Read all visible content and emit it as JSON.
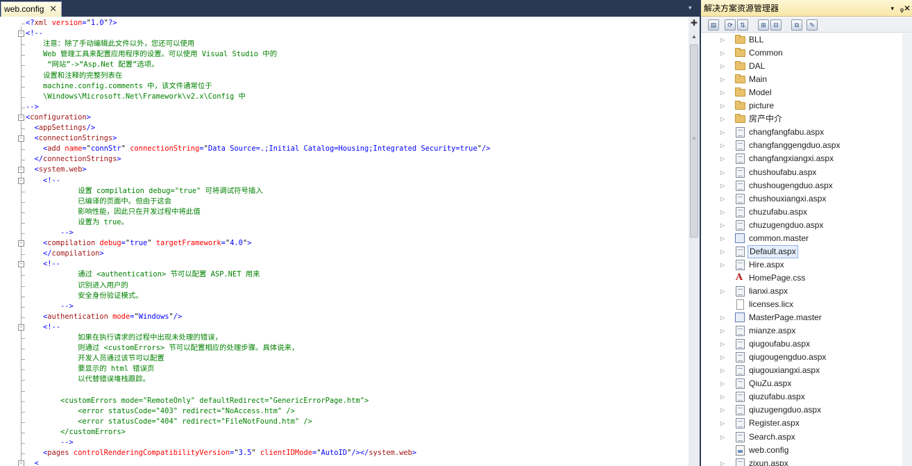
{
  "editor": {
    "tab_title": "web.config",
    "tab_close": "✕",
    "dropdown": "▾",
    "split_icon": "✚",
    "code": [
      {
        "fold": "",
        "parts": [
          [
            "bl",
            "<?"
          ],
          [
            "mr",
            "xml"
          ],
          [
            "bl",
            " "
          ],
          [
            "ar",
            "version"
          ],
          [
            "bl",
            "="
          ],
          [
            "tx",
            "\""
          ],
          [
            "bl",
            "1.0"
          ],
          [
            "tx",
            "\""
          ],
          [
            "bl",
            "?>"
          ]
        ]
      },
      {
        "fold": "-",
        "parts": [
          [
            "bl",
            "<!--"
          ]
        ]
      },
      {
        "fold": "",
        "parts": [
          [
            "cm",
            "    注意：除了手动编辑此文件以外，您还可以使用"
          ]
        ]
      },
      {
        "fold": "",
        "parts": [
          [
            "cm",
            "    Web 管理工具来配置应用程序的设置。可以使用 Visual Studio 中的"
          ]
        ]
      },
      {
        "fold": "",
        "parts": [
          [
            "cm",
            "     “网站”->“Asp.Net 配置”选项。"
          ]
        ]
      },
      {
        "fold": "",
        "parts": [
          [
            "cm",
            "    设置和注释的完整列表在"
          ]
        ]
      },
      {
        "fold": "",
        "parts": [
          [
            "cm",
            "    machine.config.comments 中，该文件通常位于"
          ]
        ]
      },
      {
        "fold": "",
        "parts": [
          [
            "cm",
            "    \\Windows\\Microsoft.Net\\Framework\\v2.x\\Config 中"
          ]
        ]
      },
      {
        "fold": "",
        "parts": [
          [
            "bl",
            "-->"
          ]
        ]
      },
      {
        "fold": "-",
        "parts": [
          [
            "bl",
            "<"
          ],
          [
            "mr",
            "configuration"
          ],
          [
            "bl",
            ">"
          ]
        ]
      },
      {
        "fold": "",
        "parts": [
          [
            "bl",
            "  <"
          ],
          [
            "mr",
            "appSettings"
          ],
          [
            "bl",
            "/>"
          ]
        ]
      },
      {
        "fold": "-",
        "parts": [
          [
            "bl",
            "  <"
          ],
          [
            "mr",
            "connectionStrings"
          ],
          [
            "bl",
            ">"
          ]
        ]
      },
      {
        "fold": "",
        "parts": [
          [
            "bl",
            "    <"
          ],
          [
            "mr",
            "add"
          ],
          [
            "bl",
            " "
          ],
          [
            "ar",
            "name"
          ],
          [
            "bl",
            "="
          ],
          [
            "tx",
            "\""
          ],
          [
            "bl",
            "connStr"
          ],
          [
            "tx",
            "\""
          ],
          [
            "bl",
            " "
          ],
          [
            "ar",
            "connectionString"
          ],
          [
            "bl",
            "="
          ],
          [
            "tx",
            "\""
          ],
          [
            "bl",
            "Data Source=.;Initial Catalog=Housing;Integrated Security=true"
          ],
          [
            "tx",
            "\""
          ],
          [
            "bl",
            "/>"
          ]
        ]
      },
      {
        "fold": "",
        "parts": [
          [
            "bl",
            "  </"
          ],
          [
            "mr",
            "connectionStrings"
          ],
          [
            "bl",
            ">"
          ]
        ]
      },
      {
        "fold": "-",
        "parts": [
          [
            "bl",
            "  <"
          ],
          [
            "mr",
            "system.web"
          ],
          [
            "bl",
            ">"
          ]
        ]
      },
      {
        "fold": "-",
        "parts": [
          [
            "bl",
            "    <!--"
          ]
        ]
      },
      {
        "fold": "",
        "parts": [
          [
            "cm",
            "            设置 compilation debug=\"true\" 可将调试符号插入"
          ]
        ]
      },
      {
        "fold": "",
        "parts": [
          [
            "cm",
            "            已编译的页面中。但由于这会"
          ]
        ]
      },
      {
        "fold": "",
        "parts": [
          [
            "cm",
            "            影响性能，因此只在开发过程中将此值"
          ]
        ]
      },
      {
        "fold": "",
        "parts": [
          [
            "cm",
            "            设置为 true。"
          ]
        ]
      },
      {
        "fold": "",
        "parts": [
          [
            "bl",
            "        -->"
          ]
        ]
      },
      {
        "fold": "-",
        "parts": [
          [
            "bl",
            "    <"
          ],
          [
            "mr",
            "compilation"
          ],
          [
            "bl",
            " "
          ],
          [
            "ar",
            "debug"
          ],
          [
            "bl",
            "="
          ],
          [
            "tx",
            "\""
          ],
          [
            "bl",
            "true"
          ],
          [
            "tx",
            "\""
          ],
          [
            "bl",
            " "
          ],
          [
            "ar",
            "targetFramework"
          ],
          [
            "bl",
            "="
          ],
          [
            "tx",
            "\""
          ],
          [
            "bl",
            "4.0"
          ],
          [
            "tx",
            "\""
          ],
          [
            "bl",
            ">"
          ]
        ]
      },
      {
        "fold": "",
        "parts": [
          [
            "bl",
            "    </"
          ],
          [
            "mr",
            "compilation"
          ],
          [
            "bl",
            ">"
          ]
        ]
      },
      {
        "fold": "-",
        "parts": [
          [
            "bl",
            "    <!--"
          ]
        ]
      },
      {
        "fold": "",
        "parts": [
          [
            "cm",
            "            通过 <authentication> 节可以配置 ASP.NET 用来"
          ]
        ]
      },
      {
        "fold": "",
        "parts": [
          [
            "cm",
            "            识别进入用户的"
          ]
        ]
      },
      {
        "fold": "",
        "parts": [
          [
            "cm",
            "            安全身份验证模式。"
          ]
        ]
      },
      {
        "fold": "",
        "parts": [
          [
            "bl",
            "        -->"
          ]
        ]
      },
      {
        "fold": "",
        "parts": [
          [
            "bl",
            "    <"
          ],
          [
            "mr",
            "authentication"
          ],
          [
            "bl",
            " "
          ],
          [
            "ar",
            "mode"
          ],
          [
            "bl",
            "="
          ],
          [
            "tx",
            "\""
          ],
          [
            "bl",
            "Windows"
          ],
          [
            "tx",
            "\""
          ],
          [
            "bl",
            "/>"
          ]
        ]
      },
      {
        "fold": "-",
        "parts": [
          [
            "bl",
            "    <!--"
          ]
        ]
      },
      {
        "fold": "",
        "parts": [
          [
            "cm",
            "            如果在执行请求的过程中出现未处理的错误，"
          ]
        ]
      },
      {
        "fold": "",
        "parts": [
          [
            "cm",
            "            则通过 <customErrors> 节可以配置相应的处理步骤。具体说来，"
          ]
        ]
      },
      {
        "fold": "",
        "parts": [
          [
            "cm",
            "            开发人员通过该节可以配置"
          ]
        ]
      },
      {
        "fold": "",
        "parts": [
          [
            "cm",
            "            要显示的 html 错误页"
          ]
        ]
      },
      {
        "fold": "",
        "parts": [
          [
            "cm",
            "            以代替错误堆栈跟踪。"
          ]
        ]
      },
      {
        "fold": "",
        "parts": [
          [
            "cm",
            ""
          ]
        ]
      },
      {
        "fold": "",
        "parts": [
          [
            "cm",
            "        <customErrors mode=\"RemoteOnly\" defaultRedirect=\"GenericErrorPage.htm\">"
          ]
        ]
      },
      {
        "fold": "",
        "parts": [
          [
            "cm",
            "            <error statusCode=\"403\" redirect=\"NoAccess.htm\" />"
          ]
        ]
      },
      {
        "fold": "",
        "parts": [
          [
            "cm",
            "            <error statusCode=\"404\" redirect=\"FileNotFound.htm\" />"
          ]
        ]
      },
      {
        "fold": "",
        "parts": [
          [
            "cm",
            "        </customErrors>"
          ]
        ]
      },
      {
        "fold": "",
        "parts": [
          [
            "bl",
            "        -->"
          ]
        ]
      },
      {
        "fold": "",
        "parts": [
          [
            "bl",
            "    <"
          ],
          [
            "mr",
            "pages"
          ],
          [
            "bl",
            " "
          ],
          [
            "ar",
            "controlRenderingCompatibilityVersion"
          ],
          [
            "bl",
            "="
          ],
          [
            "tx",
            "\""
          ],
          [
            "bl",
            "3.5"
          ],
          [
            "tx",
            "\""
          ],
          [
            "bl",
            " "
          ],
          [
            "ar",
            "clientIDMode"
          ],
          [
            "bl",
            "="
          ],
          [
            "tx",
            "\""
          ],
          [
            "bl",
            "AutoID"
          ],
          [
            "tx",
            "\""
          ],
          [
            "bl",
            "/></"
          ],
          [
            "mr",
            "system.web"
          ],
          [
            "bl",
            ">"
          ]
        ]
      },
      {
        "fold": "-",
        "parts": [
          [
            "bl",
            "  <"
          ]
        ]
      }
    ]
  },
  "solution_explorer": {
    "title": "解决方案资源管理器",
    "pin": "▾",
    "dock": "ᵩ",
    "close": "✕",
    "toolbar": [
      "▤",
      "⟳",
      "⇅",
      "⊞",
      "⊟",
      "⧉",
      "✎"
    ],
    "items": [
      {
        "label": "BLL",
        "icon": "folder",
        "expand": true
      },
      {
        "label": "Common",
        "icon": "folder",
        "expand": true
      },
      {
        "label": "DAL",
        "icon": "folder",
        "expand": true
      },
      {
        "label": "Main",
        "icon": "folder",
        "expand": true
      },
      {
        "label": "Model",
        "icon": "folder",
        "expand": true
      },
      {
        "label": "picture",
        "icon": "folder",
        "expand": true
      },
      {
        "label": "房产中介",
        "icon": "folder",
        "expand": true
      },
      {
        "label": "changfangfabu.aspx",
        "icon": "page",
        "expand": true
      },
      {
        "label": "changfanggengduo.aspx",
        "icon": "page",
        "expand": true
      },
      {
        "label": "changfangxiangxi.aspx",
        "icon": "page",
        "expand": true
      },
      {
        "label": "chushoufabu.aspx",
        "icon": "page",
        "expand": true
      },
      {
        "label": "chushougengduo.aspx",
        "icon": "page",
        "expand": true
      },
      {
        "label": "chushouxiangxi.aspx",
        "icon": "page",
        "expand": true
      },
      {
        "label": "chuzufabu.aspx",
        "icon": "page",
        "expand": true
      },
      {
        "label": "chuzugengduo.aspx",
        "icon": "page",
        "expand": true
      },
      {
        "label": "common.master",
        "icon": "master",
        "expand": true
      },
      {
        "label": "Default.aspx",
        "icon": "page",
        "expand": true,
        "selected": true
      },
      {
        "label": "Hire.aspx",
        "icon": "page",
        "expand": true
      },
      {
        "label": "HomePage.css",
        "icon": "css",
        "expand": false
      },
      {
        "label": "lianxi.aspx",
        "icon": "page",
        "expand": true
      },
      {
        "label": "licenses.licx",
        "icon": "lic",
        "expand": false
      },
      {
        "label": "MasterPage.master",
        "icon": "master",
        "expand": true
      },
      {
        "label": "mianze.aspx",
        "icon": "page",
        "expand": true
      },
      {
        "label": "qiugoufabu.aspx",
        "icon": "page",
        "expand": true
      },
      {
        "label": "qiugougengduo.aspx",
        "icon": "page",
        "expand": true
      },
      {
        "label": "qiugouxiangxi.aspx",
        "icon": "page",
        "expand": true
      },
      {
        "label": "QiuZu.aspx",
        "icon": "page",
        "expand": true
      },
      {
        "label": "qiuzufabu.aspx",
        "icon": "page",
        "expand": true
      },
      {
        "label": "qiuzugengduo.aspx",
        "icon": "page",
        "expand": true
      },
      {
        "label": "Register.aspx",
        "icon": "page",
        "expand": true
      },
      {
        "label": "Search.aspx",
        "icon": "page",
        "expand": true
      },
      {
        "label": "web.config",
        "icon": "config",
        "expand": false
      },
      {
        "label": "zixun.aspx",
        "icon": "page",
        "expand": true
      }
    ]
  }
}
